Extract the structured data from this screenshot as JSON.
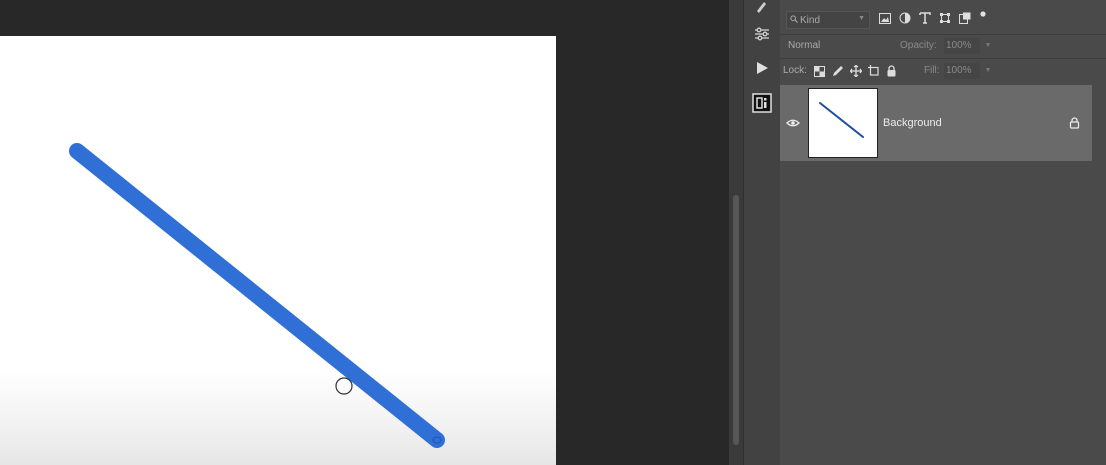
{
  "icons": {
    "strip": [
      "brush-settings-icon",
      "adjustments-icon",
      "play-action-icon",
      "libraries-icon"
    ],
    "filters": [
      "image-filter-icon",
      "adjustment-filter-icon",
      "type-filter-icon",
      "shape-filter-icon",
      "smart-object-filter-icon",
      "filter-toggle-icon"
    ],
    "locks": [
      "lock-transparent-pixels-icon",
      "lock-image-pixels-icon",
      "lock-position-icon",
      "lock-artboard-icon",
      "lock-all-icon"
    ]
  },
  "colors": {
    "stroke": "#2f6fd6",
    "panel": "#4a4a4a",
    "selected_layer": "#6a6a6a",
    "workspace": "#282828"
  },
  "layers_panel": {
    "kind_filter": "Kind",
    "blend_mode": "Normal",
    "opacity_label": "Opacity:",
    "opacity_value": "100%",
    "lock_label": "Lock:",
    "fill_label": "Fill:",
    "fill_value": "100%",
    "layers": [
      {
        "name": "Background",
        "visible": true,
        "locked": true
      }
    ]
  }
}
